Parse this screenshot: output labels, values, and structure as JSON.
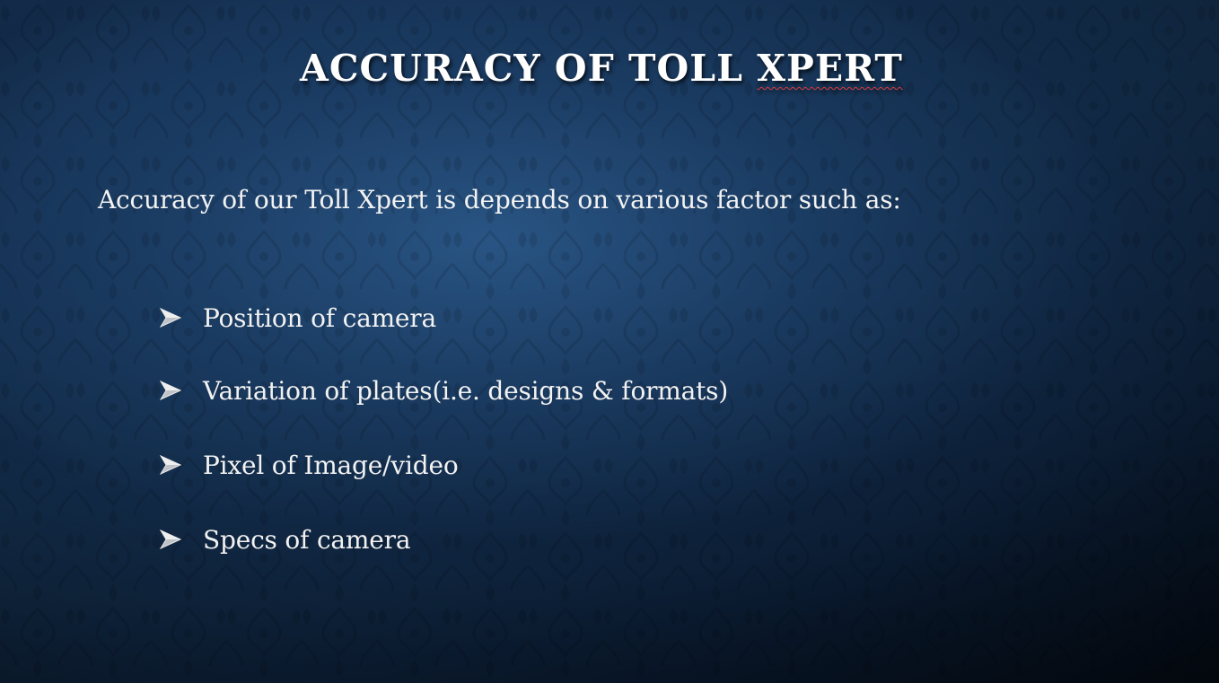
{
  "slide": {
    "title_main": "ACCURACY OF TOLL ",
    "title_emph": "XPERT",
    "intro": "Accuracy of our Toll Xpert is depends on various factor such as:",
    "bullet_icon": "arrowhead-bullet-icon",
    "bullets": [
      "Position of camera",
      "Variation of plates(i.e. designs & formats)",
      "Pixel of Image/video",
      "Specs of camera"
    ]
  },
  "colors": {
    "background": "#14304f",
    "text": "#f2f2f2",
    "spellcheck_underline": "#d23a3a"
  }
}
